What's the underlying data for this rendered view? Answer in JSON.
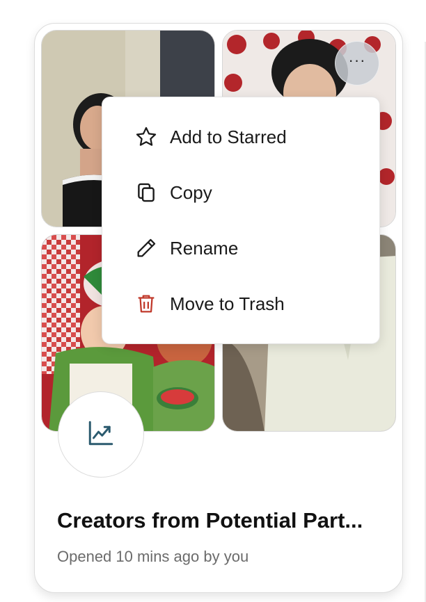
{
  "board": {
    "title": "Creators from Potential Part...",
    "subtitle": "Opened 10 mins ago by you"
  },
  "more_button": {
    "glyph": "···"
  },
  "context_menu": {
    "items": [
      {
        "label": "Add to Starred",
        "icon": "star-icon"
      },
      {
        "label": "Copy",
        "icon": "copy-icon"
      },
      {
        "label": "Rename",
        "icon": "pencil-icon"
      },
      {
        "label": "Move to Trash",
        "icon": "trash-icon",
        "color": "#c0392b"
      }
    ]
  },
  "badge": {
    "icon": "line-chart-icon",
    "color": "#2b5a6e"
  }
}
